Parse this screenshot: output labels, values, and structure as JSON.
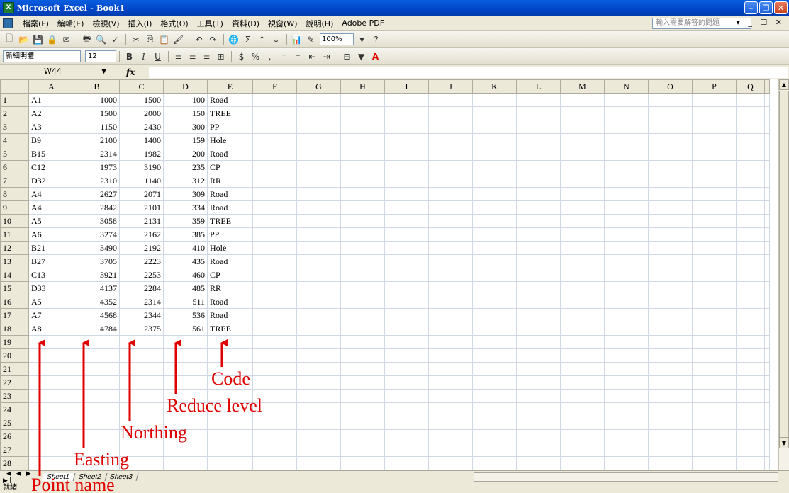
{
  "window": {
    "title": "Microsoft Excel - Book1",
    "app_icon": "X"
  },
  "menu": {
    "items": [
      "檔案(F)",
      "編輯(E)",
      "檢視(V)",
      "插入(I)",
      "格式(O)",
      "工具(T)",
      "資料(D)",
      "視窗(W)",
      "說明(H)",
      "Adobe PDF"
    ],
    "help_placeholder": "輸入需要解答的問題"
  },
  "toolbar": {
    "zoom": "100%",
    "font_name": "新細明體",
    "font_size": "12"
  },
  "formula_bar": {
    "cell_ref": "W44",
    "fx": "fx"
  },
  "grid": {
    "columns": [
      "A",
      "B",
      "C",
      "D",
      "E",
      "F",
      "G",
      "H",
      "I",
      "J",
      "K",
      "L",
      "M",
      "N",
      "O",
      "P",
      "Q"
    ],
    "rows": [
      [
        "A1",
        "1000",
        "1500",
        "100",
        "Road"
      ],
      [
        "A2",
        "1500",
        "2000",
        "150",
        "TREE"
      ],
      [
        "A3",
        "1150",
        "2430",
        "300",
        "PP"
      ],
      [
        "B9",
        "2100",
        "1400",
        "159",
        "Hole"
      ],
      [
        "B15",
        "2314",
        "1982",
        "200",
        "Road"
      ],
      [
        "C12",
        "1973",
        "3190",
        "235",
        "CP"
      ],
      [
        "D32",
        "2310",
        "1140",
        "312",
        "RR"
      ],
      [
        "A4",
        "2627",
        "2071",
        "309",
        "Road"
      ],
      [
        "A4",
        "2842",
        "2101",
        "334",
        "Road"
      ],
      [
        "A5",
        "3058",
        "2131",
        "359",
        "TREE"
      ],
      [
        "A6",
        "3274",
        "2162",
        "385",
        "PP"
      ],
      [
        "B21",
        "3490",
        "2192",
        "410",
        "Hole"
      ],
      [
        "B27",
        "3705",
        "2223",
        "435",
        "Road"
      ],
      [
        "C13",
        "3921",
        "2253",
        "460",
        "CP"
      ],
      [
        "D33",
        "4137",
        "2284",
        "485",
        "RR"
      ],
      [
        "A5",
        "4352",
        "2314",
        "511",
        "Road"
      ],
      [
        "A7",
        "4568",
        "2344",
        "536",
        "Road"
      ],
      [
        "A8",
        "4784",
        "2375",
        "561",
        "TREE"
      ]
    ],
    "total_rows": 28
  },
  "sheets": [
    "Sheet1",
    "Sheet2",
    "Sheet3"
  ],
  "status": "就緒",
  "annotations": {
    "code": "Code",
    "reduce_level": "Reduce level",
    "northing": "Northing",
    "easting": "Easting",
    "point_name": "Point name"
  },
  "annotation_color": "#e00000"
}
